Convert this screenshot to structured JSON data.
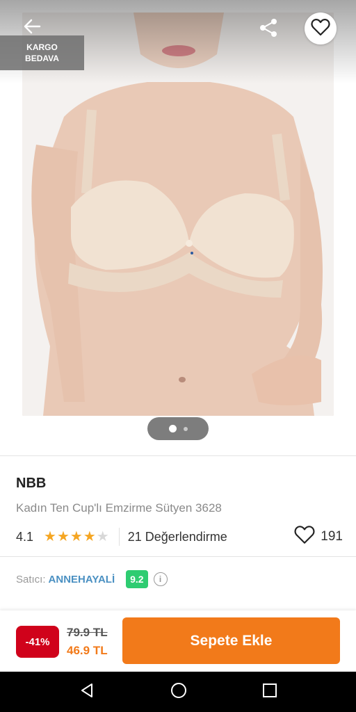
{
  "header": {
    "back_icon": "arrow-left-icon",
    "share_icon": "share-icon",
    "favorite_icon": "heart-outline-icon"
  },
  "badge": {
    "line1": "KARGO",
    "line2": "BEDAVA"
  },
  "gallery": {
    "image_description": "product photo",
    "total_images": 2,
    "active_index": 0
  },
  "product": {
    "brand": "NBB",
    "title": "Kadın Ten Cup'lı Emzirme Sütyen 3628",
    "rating": "4.1",
    "stars_filled": 4,
    "stars_total": 5,
    "reviews": "21 Değerlendirme",
    "likes": "191"
  },
  "seller": {
    "label": "Satıcı:",
    "name": "ANNEHAYALİ",
    "score": "9.2",
    "info_icon": "info-icon"
  },
  "purchase": {
    "discount": "-41%",
    "old_price": "79.9 TL",
    "new_price": "46.9 TL",
    "add_to_cart": "Sepete Ekle"
  },
  "system_nav": {
    "back": "triangle-back-icon",
    "home": "circle-home-icon",
    "recents": "square-recents-icon"
  },
  "colors": {
    "accent": "#f27a1a",
    "discount": "#d0021b",
    "seller_link": "#4a90c2",
    "score_badge": "#2ecc71",
    "star": "#f5a623"
  }
}
